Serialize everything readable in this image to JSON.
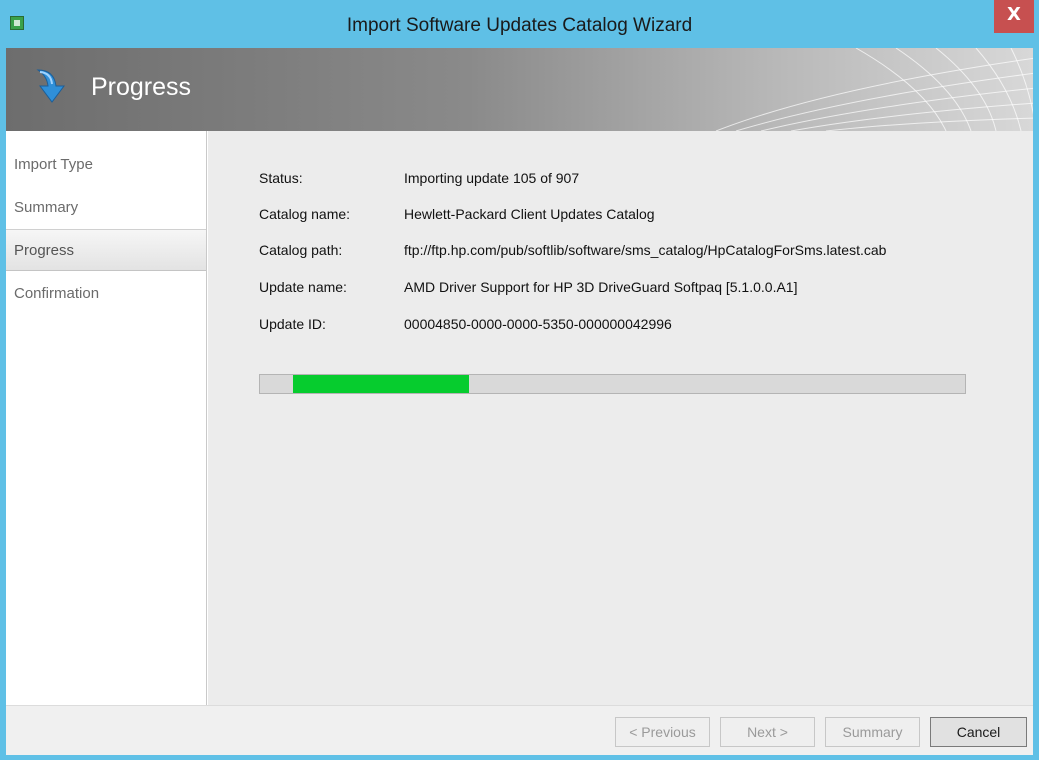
{
  "window": {
    "title": "Import Software Updates Catalog Wizard",
    "close_glyph": "X"
  },
  "banner": {
    "title": "Progress"
  },
  "sidebar": {
    "items": [
      {
        "label": "Import Type",
        "active": false
      },
      {
        "label": "Summary",
        "active": false
      },
      {
        "label": "Progress",
        "active": true
      },
      {
        "label": "Confirmation",
        "active": false
      }
    ]
  },
  "details": {
    "status_label": "Status:",
    "status_value": "Importing update 105 of 907",
    "catalog_name_label": "Catalog name:",
    "catalog_name_value": "Hewlett-Packard Client Updates Catalog",
    "catalog_path_label": "Catalog path:",
    "catalog_path_value": "ftp://ftp.hp.com/pub/softlib/software/sms_catalog/HpCatalogForSms.latest.cab",
    "update_name_label": "Update name:",
    "update_name_value": "AMD Driver Support for HP 3D DriveGuard Softpaq [5.1.0.0.A1]",
    "update_id_label": "Update ID:",
    "update_id_value": "00004850-0000-0000-5350-000000042996"
  },
  "progress": {
    "fill_color": "#06cc2e"
  },
  "footer": {
    "previous_label": "< Previous",
    "next_label": "Next >",
    "summary_label": "Summary",
    "cancel_label": "Cancel"
  },
  "colors": {
    "titlebar": "#5fc0e6",
    "close_button": "#c75050",
    "content_bg": "#ececec"
  }
}
